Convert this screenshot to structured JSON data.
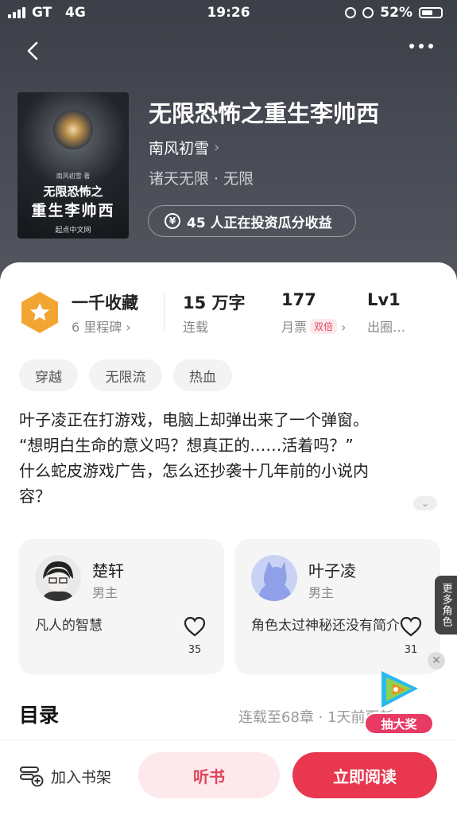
{
  "status_bar": {
    "carrier": "GT",
    "network": "4G",
    "time": "19:26",
    "battery": "52%"
  },
  "book": {
    "title": "无限恐怖之重生李帅西",
    "author": "南风初雪",
    "genre": "诸天无限 · 无限",
    "invest_text": "45 人正在投资瓜分收益",
    "cover": {
      "author_small": "南风初雪 著",
      "title_line1": "无限恐怖之",
      "title_line2": "重生李帅西",
      "publisher": "起点中文网"
    }
  },
  "stats": {
    "collect": {
      "main": "一千收藏",
      "sub": "6 里程碑"
    },
    "words": {
      "main": "15 万字",
      "sub": "连载"
    },
    "tickets": {
      "main": "177",
      "sub": "月票",
      "badge": "双倍"
    },
    "level": {
      "main": "Lv1",
      "sub": "出圈…"
    }
  },
  "tags": [
    "穿越",
    "无限流",
    "热血"
  ],
  "description": [
    "叶子凌正在打游戏，电脑上却弹出来了一个弹窗。",
    "“想明白生命的意义吗？想真正的……活着吗？”",
    "什么蛇皮游戏广告，怎么还抄袭十几年前的小说内",
    "容？"
  ],
  "characters": [
    {
      "name": "楚轩",
      "role": "男主",
      "desc": "凡人的智慧",
      "likes": "35"
    },
    {
      "name": "叶子凌",
      "role": "男主",
      "desc": "角色太过神秘还没有简介",
      "likes": "31"
    }
  ],
  "more_characters_label": "更多角色",
  "toc": {
    "title": "目录",
    "status": "连载至68章 · 1天前更新"
  },
  "lottery_label": "抽大奖",
  "bottom_bar": {
    "shelf": "加入书架",
    "listen": "听书",
    "read": "立即阅读"
  },
  "colors": {
    "accent": "#e8374f",
    "hero_bg": "#45484f",
    "badge_gold": "#f2a531"
  }
}
